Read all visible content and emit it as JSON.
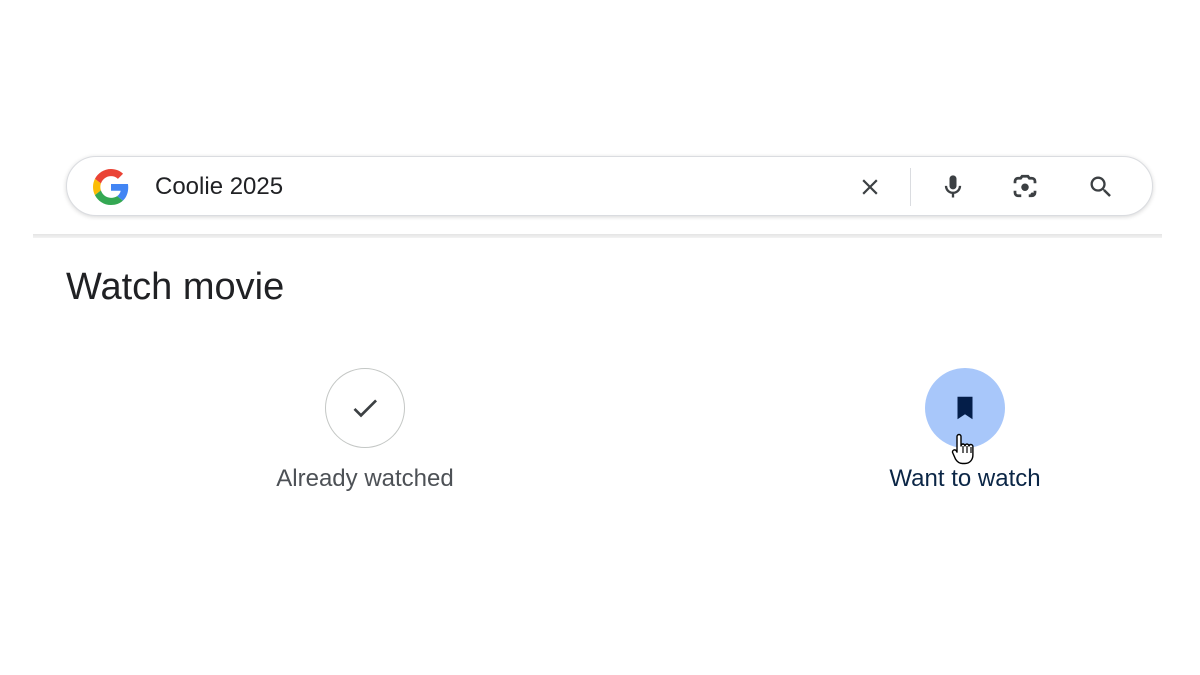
{
  "search": {
    "query": "Coolie 2025",
    "icons": {
      "logo": "google-g-logo",
      "clear": "close-icon",
      "voice": "microphone-icon",
      "lens": "camera-lens-icon",
      "submit": "magnifier-icon"
    }
  },
  "section": {
    "title": "Watch movie"
  },
  "actions": [
    {
      "label": "Already watched",
      "icon": "check-icon",
      "active": false
    },
    {
      "label": "Want to watch",
      "icon": "bookmark-icon",
      "active": true
    }
  ],
  "colors": {
    "active_circle": "#a8c7fa",
    "active_label": "#0b2646",
    "inactive_label": "#4d5156",
    "google_blue": "#4285F4",
    "google_red": "#EA4335",
    "google_yellow": "#FBBC05",
    "google_green": "#34A853"
  }
}
